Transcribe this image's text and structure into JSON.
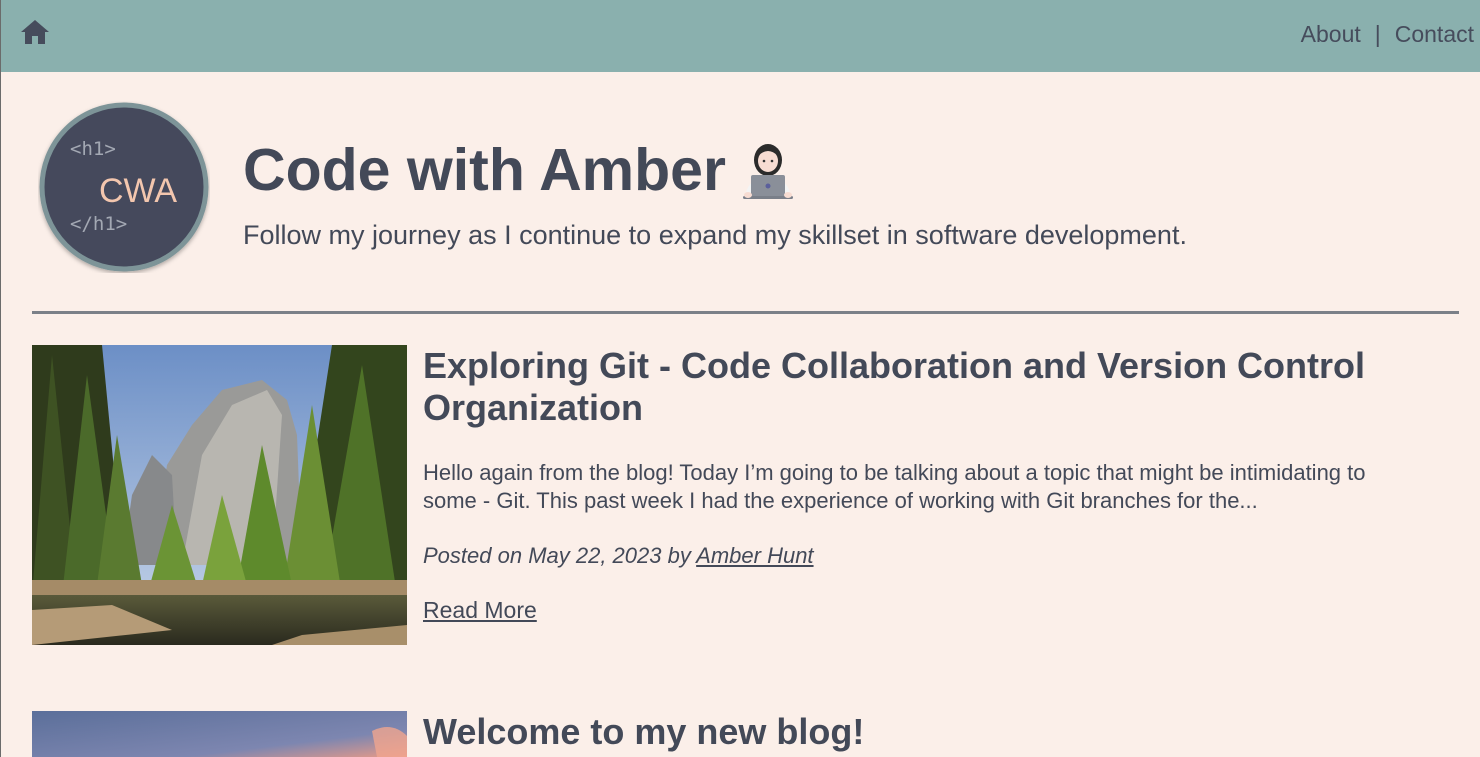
{
  "nav": {
    "home_icon": "home-icon",
    "about": "About",
    "separator": "|",
    "contact": "Contact"
  },
  "header": {
    "logo": {
      "line1": "<h1>",
      "main": "CWA",
      "line2": "</h1>"
    },
    "title": "Code with Amber",
    "title_emoji": "woman-technologist-icon",
    "subtitle": "Follow my journey as I continue to expand my skillset in software development."
  },
  "posts": [
    {
      "title": "Exploring Git - Code Collaboration and Version Control Organization",
      "excerpt": "Hello again from the blog! Today I’m going to be talking about a topic that might be intimidating to some - Git. This past week I had the experience of working with Git branches for the...",
      "meta_prefix": "Posted on May 22, 2023 by ",
      "author": "Amber Hunt",
      "read_more": "Read More",
      "image": "forest-mountain-photo"
    },
    {
      "title": "Welcome to my new blog!",
      "image": "sunset-photo"
    }
  ],
  "colors": {
    "topbar": "#8ab0ae",
    "background": "#fbefe9",
    "text": "#434958",
    "logo_circle": "#444a5c",
    "logo_accent": "#f3c6ae"
  }
}
